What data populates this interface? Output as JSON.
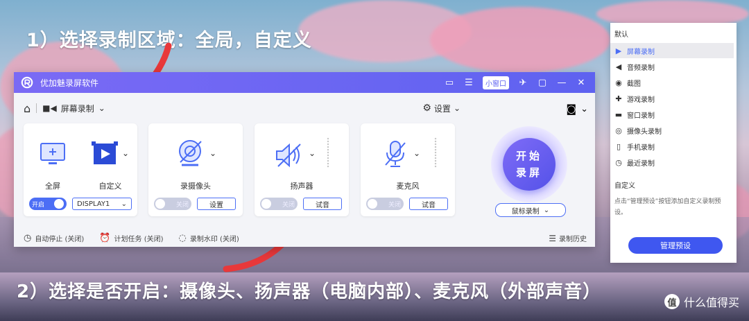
{
  "annotations": {
    "step1": "1）选择录制区域：全局，自定义",
    "step2": "2）选择是否开启：摄像头、扬声器（电脑内部）、麦克风（外部声音）"
  },
  "watermark": {
    "logo": "值",
    "text": "什么值得买"
  },
  "app": {
    "title": "优加魅录屏软件",
    "mini_window": "小窗口",
    "mode": "屏幕录制",
    "settings": "设置",
    "cards": {
      "screen": {
        "fullscreen_label": "全屏",
        "custom_label": "自定义",
        "toggle": "开启",
        "display_select": "DISPLAY1"
      },
      "camera": {
        "label": "录摄像头",
        "toggle": "关闭",
        "button": "设置"
      },
      "speaker": {
        "label": "扬声器",
        "toggle": "关闭",
        "button": "试音"
      },
      "mic": {
        "label": "麦克风",
        "toggle": "关闭",
        "button": "试音"
      }
    },
    "start_line1": "开始",
    "start_line2": "录屏",
    "mouse_mode": "鼠标录制",
    "bottom": {
      "auto_stop": "自动停止 (关闭)",
      "schedule": "计划任务 (关闭)",
      "watermark": "录制水印 (关闭)",
      "history": "录制历史"
    }
  },
  "panel": {
    "section_default": "默认",
    "items": [
      {
        "label": "屏幕录制",
        "icon": "video-icon",
        "glyph": "▶"
      },
      {
        "label": "音频录制",
        "icon": "speaker-icon",
        "glyph": "◀"
      },
      {
        "label": "截图",
        "icon": "camera-icon",
        "glyph": "◉"
      },
      {
        "label": "游戏录制",
        "icon": "gamepad-icon",
        "glyph": "✚"
      },
      {
        "label": "窗口录制",
        "icon": "window-icon",
        "glyph": "▬"
      },
      {
        "label": "摄像头录制",
        "icon": "webcam-icon",
        "glyph": "◎"
      },
      {
        "label": "手机录制",
        "icon": "phone-icon",
        "glyph": "▯"
      },
      {
        "label": "最近录制",
        "icon": "clock-icon",
        "glyph": "◷"
      }
    ],
    "section_custom": "自定义",
    "hint": "点击“管理预设”按钮添加自定义录制预设。",
    "manage_button": "管理预设"
  },
  "colors": {
    "accent": "#4c6ef5",
    "titlebar": "#6a66f2",
    "arrow": "#e8383a"
  }
}
